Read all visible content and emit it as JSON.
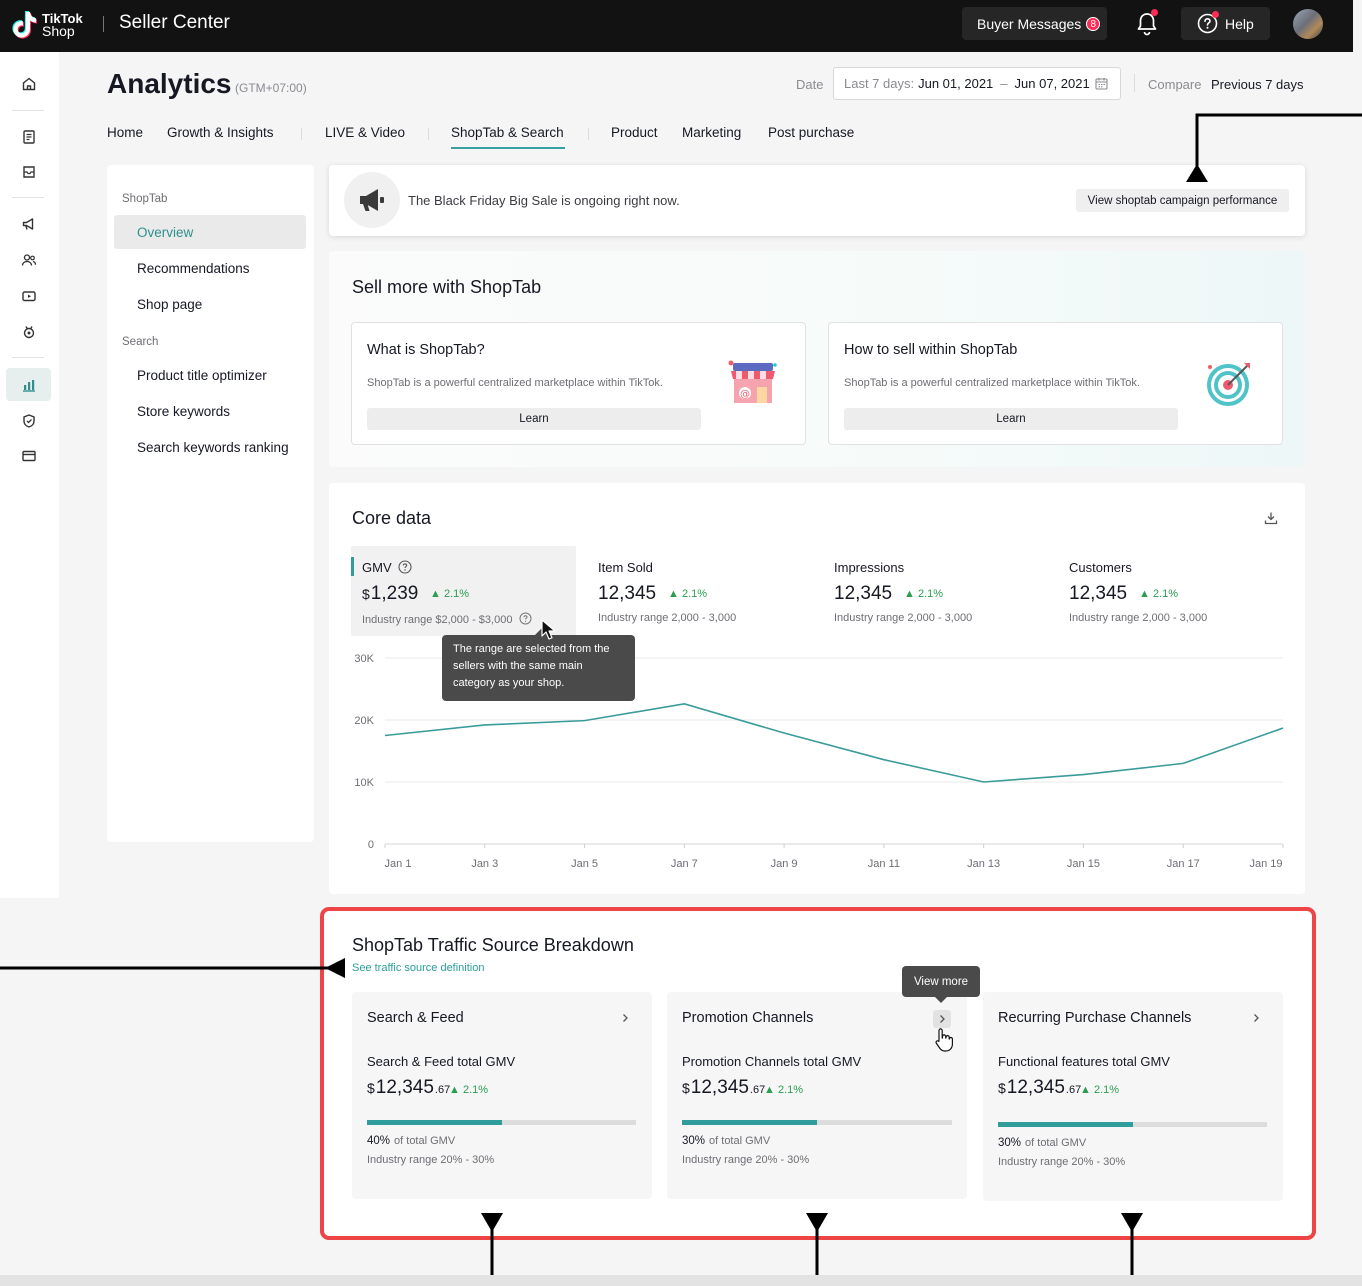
{
  "topbar": {
    "logo_line1": "TikTok",
    "logo_line2": "Shop",
    "title": "Seller Center",
    "buyer_messages_label": "Buyer Messages",
    "buyer_messages_count": "8",
    "help_label": "Help"
  },
  "header": {
    "title": "Analytics",
    "timezone": "(GTM+07:00)",
    "date_label": "Date",
    "date_range_prefix": "Last 7 days:",
    "date_start": "Jun 01, 2021",
    "date_sep": "–",
    "date_end": "Jun 07, 2021",
    "compare_label": "Compare",
    "compare_value": "Previous 7 days"
  },
  "tabs": [
    "Home",
    "Growth & Insights",
    "LIVE & Video",
    "ShopTab & Search",
    "Product",
    "Marketing",
    "Post purchase"
  ],
  "active_tab": "ShopTab & Search",
  "subnav": {
    "group1": "ShopTab",
    "group1_items": [
      "Overview",
      "Recommendations",
      "Shop page"
    ],
    "group2": "Search",
    "group2_items": [
      "Product title optimizer",
      "Store keywords",
      "Search keywords ranking"
    ]
  },
  "banner": {
    "text": "The Black Friday Big Sale is ongoing right now.",
    "button": "View shoptab campaign performance"
  },
  "sellmore": {
    "title": "Sell more with ShopTab",
    "cards": [
      {
        "title": "What is ShopTab?",
        "desc": "ShopTab is a powerful centralized marketplace within TikTok.",
        "button": "Learn"
      },
      {
        "title": "How to sell within ShopTab",
        "desc": "ShopTab is a powerful centralized marketplace within TikTok.",
        "button": "Learn"
      }
    ]
  },
  "core": {
    "title": "Core data",
    "metrics": [
      {
        "label": "GMV",
        "currency": "$",
        "value": "1,239",
        "delta": "2.1%",
        "range": "Industry range $2,000 - $3,000"
      },
      {
        "label": "Item Sold",
        "currency": "",
        "value": "12,345",
        "delta": "2.1%",
        "range": "Industry range 2,000 - 3,000"
      },
      {
        "label": "Impressions",
        "currency": "",
        "value": "12,345",
        "delta": "2.1%",
        "range": "Industry range 2,000 - 3,000"
      },
      {
        "label": "Customers",
        "currency": "",
        "value": "12,345",
        "delta": "2.1%",
        "range": "Industry range 2,000 - 3,000"
      }
    ],
    "tooltip": "The range are selected from the sellers with the same main category as your shop."
  },
  "chart_data": {
    "type": "line",
    "x": [
      "Jan 1",
      "Jan 3",
      "Jan 5",
      "Jan 7",
      "Jan 9",
      "Jan 11",
      "Jan 13",
      "Jan 15",
      "Jan 17",
      "Jan 19"
    ],
    "y_ticks": [
      "0",
      "10K",
      "20K",
      "30K"
    ],
    "ylim": [
      0,
      30000
    ],
    "series": [
      {
        "values": [
          17500,
          19200,
          19900,
          22600,
          17900,
          13600,
          10000,
          11200,
          13000,
          18700
        ]
      }
    ],
    "line_color": "#3a9c9a",
    "grid": true
  },
  "traffic": {
    "title": "ShopTab Traffic Source Breakdown",
    "link": "See traffic source definition",
    "view_more": "View more",
    "cards": [
      {
        "title": "Search & Feed",
        "sub": "Search & Feed total GMV",
        "currency": "$",
        "value": "12,345",
        "decimal": ".67",
        "delta": "2.1%",
        "share_pct": "40%",
        "share_label": "of total GMV",
        "share_fraction": 0.5,
        "range": "Industry range 20% - 30%"
      },
      {
        "title": "Promotion Channels",
        "sub": "Promotion Channels total GMV",
        "currency": "$",
        "value": "12,345",
        "decimal": ".67",
        "delta": "2.1%",
        "share_pct": "30%",
        "share_label": "of total GMV",
        "share_fraction": 0.5,
        "range": "Industry range 20% - 30%"
      },
      {
        "title": "Recurring Purchase Channels",
        "sub": "Functional features total GMV",
        "currency": "$",
        "value": "12,345",
        "decimal": ".67",
        "delta": "2.1%",
        "share_pct": "30%",
        "share_label": "of total GMV",
        "share_fraction": 0.5,
        "range": "Industry range 20% - 30%"
      }
    ]
  },
  "colors": {
    "accent": "#38a2a0",
    "positive": "#2a9d52",
    "highlight_frame": "#ed4545",
    "topbar": "#121212"
  }
}
